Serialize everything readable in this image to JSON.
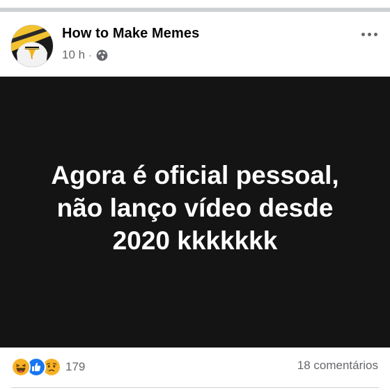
{
  "post": {
    "page_name": "How to Make Memes",
    "time": "10 h",
    "separator": "·",
    "privacy_icon": "globe-icon",
    "more_icon": "more-dots-icon",
    "avatar_icon": "eagle-avatar-icon"
  },
  "media": {
    "caption": "Agora é oficial pessoal,\nnão lanço vídeo desde\n2020 kkkkkkk"
  },
  "footer": {
    "reactions": [
      "haha-icon",
      "like-icon",
      "sad-icon"
    ],
    "reaction_count": "179",
    "comments": "18 comentários"
  },
  "colors": {
    "like": "#1877f2",
    "haha": "#f7b125",
    "secondary_text": "#65676b"
  }
}
